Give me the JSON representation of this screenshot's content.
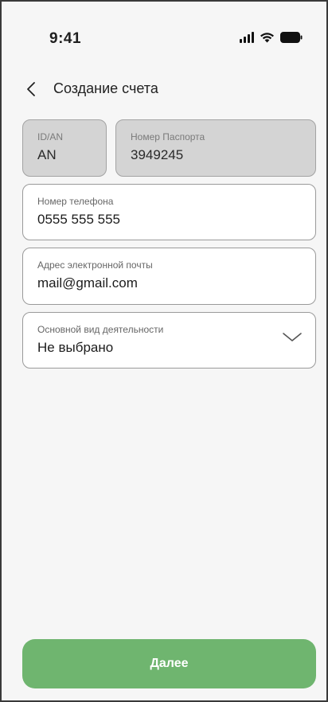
{
  "status_bar": {
    "time": "9:41"
  },
  "header": {
    "title": "Создание счета",
    "back_icon": "chevron-left-icon"
  },
  "form": {
    "id_type": {
      "label": "ID/AN",
      "value": "AN",
      "disabled": true
    },
    "passport": {
      "label": "Номер Паспорта",
      "value": "3949245",
      "disabled": true
    },
    "phone": {
      "label": "Номер телефона",
      "value": "0555 555 555"
    },
    "email": {
      "label": "Адрес электронной почты",
      "value": "mail@gmail.com"
    },
    "activity": {
      "label": "Основной вид деятельности",
      "value": "Не выбрано",
      "icon": "chevron-down-icon"
    }
  },
  "footer": {
    "next_label": "Далее"
  },
  "colors": {
    "accent": "#6fb56f",
    "disabled_field": "#d4d4d4",
    "background": "#f6f6f6"
  }
}
